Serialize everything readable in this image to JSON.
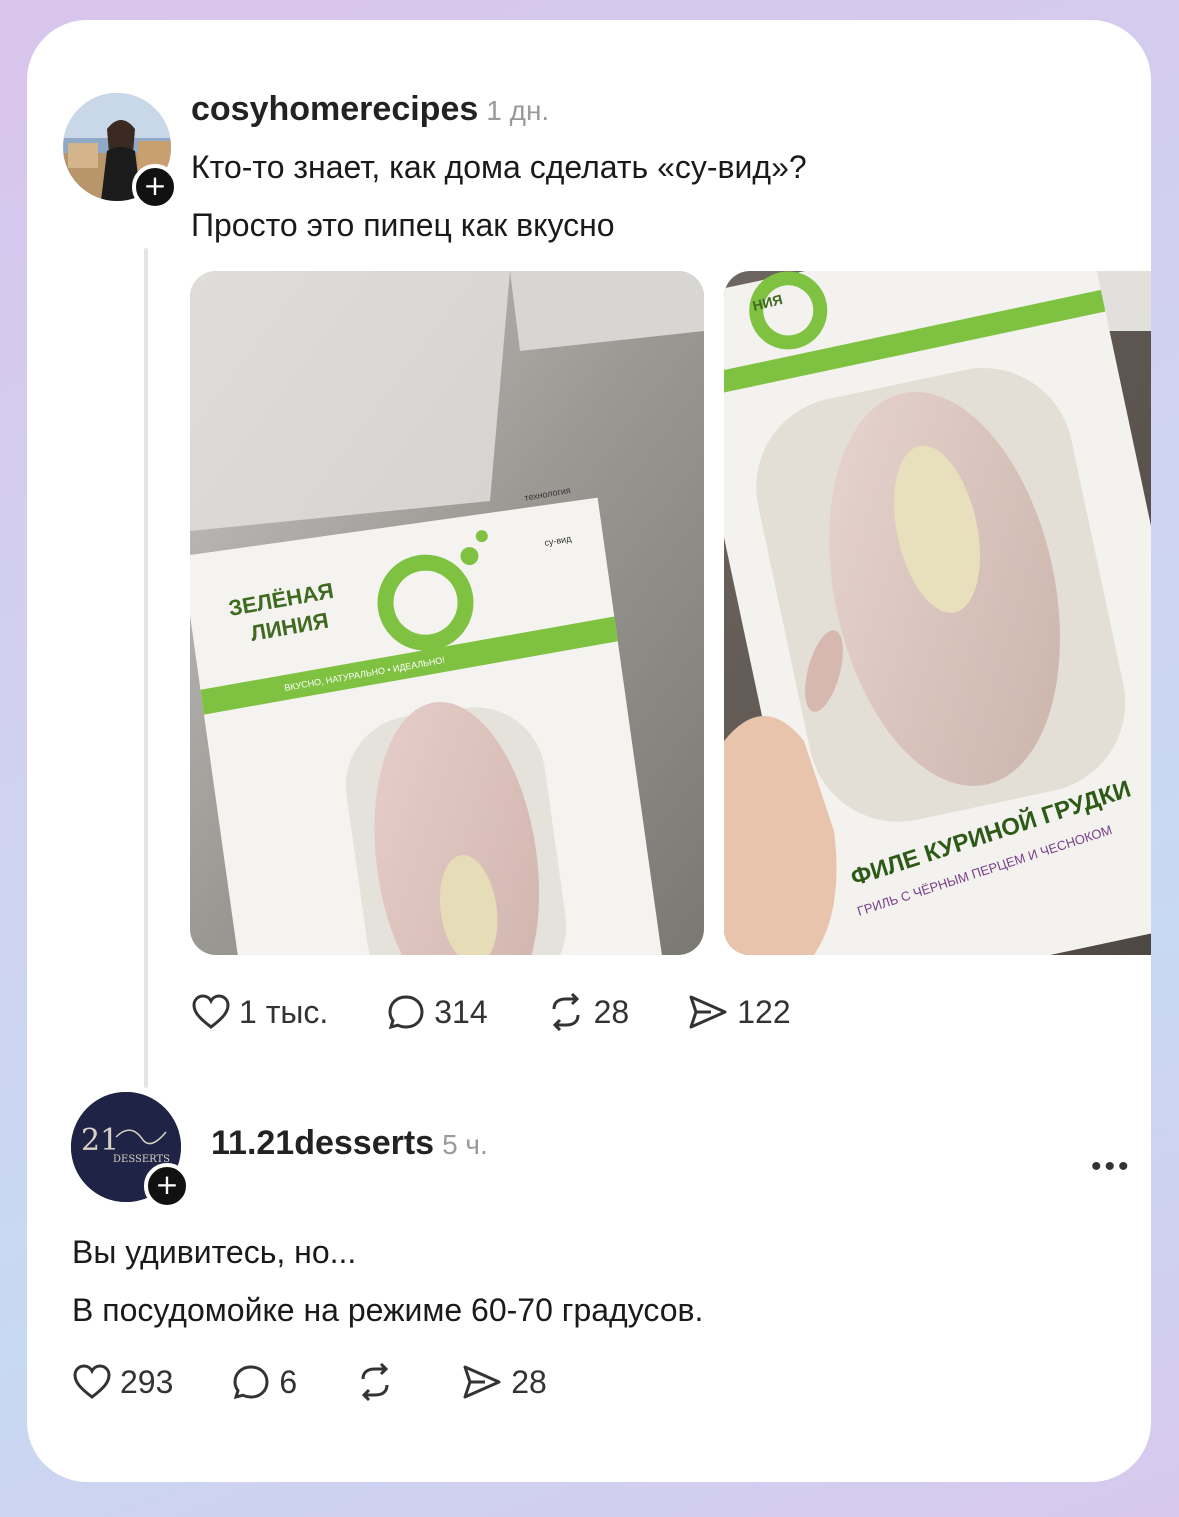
{
  "post": {
    "username": "cosyhomerecipes",
    "time": "1 дн.",
    "lines": [
      "Кто-то знает, как дома сделать «су-вид»?",
      "Просто это пипец как вкусно"
    ],
    "photo1": {
      "brand_line1": "ЗЕЛЁНАЯ",
      "brand_line2": "ЛИНИЯ",
      "stripe": "ВКУСНО, НАТУРАЛЬНО • ИДЕАЛЬНО!",
      "badge_line1": "технология",
      "badge_line2": "су-вид"
    },
    "photo2": {
      "corner": "НИЯ",
      "product_line1": "ФИЛЕ КУРИНОЙ ГРУДКИ",
      "product_line2": "ГРИЛЬ С ЧЁРНЫМ ПЕРЦЕМ И ЧЕСНОКОМ"
    },
    "stats": {
      "likes": "1 тыс.",
      "comments": "314",
      "reposts": "28",
      "shares": "122"
    }
  },
  "reply": {
    "username": "11.21desserts",
    "time": "5 ч.",
    "avatar_text": "DESSERTS",
    "lines": [
      "Вы удивитесь, но...",
      "В посудомойке на режиме 60-70 градусов."
    ],
    "stats": {
      "likes": "293",
      "comments": "6",
      "reposts": "",
      "shares": "28"
    }
  },
  "icons": {
    "like": "heart-icon",
    "comment": "comment-bubble-icon",
    "repost": "repost-icon",
    "share": "share-arrow-icon",
    "more": "more-dots-icon",
    "follow": "plus-icon"
  },
  "colors": {
    "brand_green": "#7fc242",
    "text": "#1a1a1a",
    "muted": "#9a9a9a"
  }
}
